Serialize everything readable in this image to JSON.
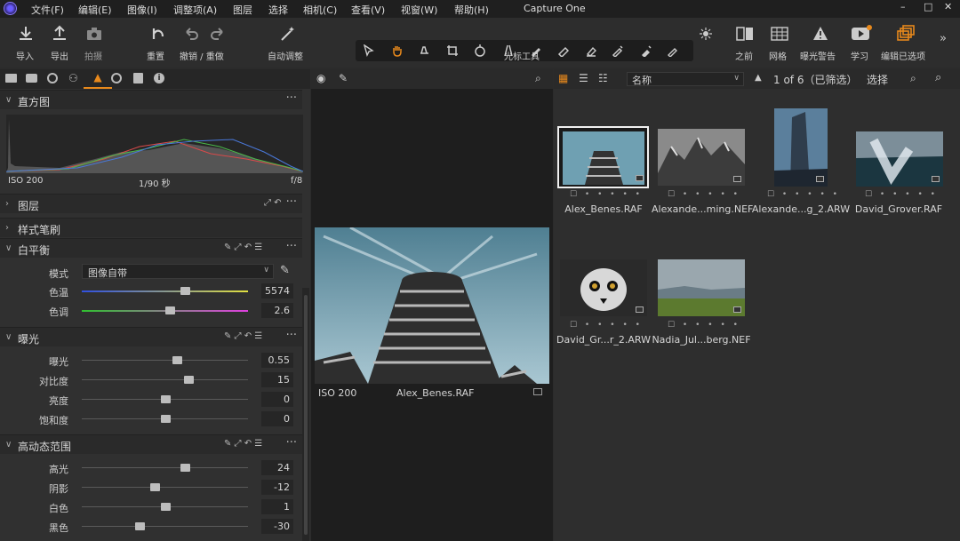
{
  "app": {
    "title": "Capture One"
  },
  "menu": [
    "文件(F)",
    "编辑(E)",
    "图像(I)",
    "调整项(A)",
    "图层",
    "选择",
    "相机(C)",
    "查看(V)",
    "视窗(W)",
    "帮助(H)"
  ],
  "toolbar": {
    "import": "导入",
    "export": "导出",
    "capture": "拍摄",
    "reset": "重置",
    "undo_redo": "撤销 / 重做",
    "auto_adjust": "自动调整",
    "cursor_tools": "光标工具",
    "before": "之前",
    "grid": "网格",
    "exposure_warning": "曝光警告",
    "learn": "学习",
    "edit_selected": "编辑已选项"
  },
  "histogram": {
    "title": "直方图",
    "iso": "ISO 200",
    "shutter": "1/90 秒",
    "aperture": "f/8"
  },
  "sections": {
    "layers": "图层",
    "style_brushes": "样式笔刷",
    "white_balance": "白平衡",
    "exposure": "曝光",
    "hdr": "高动态范围"
  },
  "white_balance": {
    "mode_label": "模式",
    "mode_value": "图像自带",
    "rows": [
      {
        "label": "色温",
        "value": "5574",
        "pos": 0.62
      },
      {
        "label": "色调",
        "value": "2.6",
        "pos": 0.53
      }
    ]
  },
  "exposure": {
    "rows": [
      {
        "label": "曝光",
        "value": "0.55",
        "pos": 0.57
      },
      {
        "label": "对比度",
        "value": "15",
        "pos": 0.64
      },
      {
        "label": "亮度",
        "value": "0",
        "pos": 0.5
      },
      {
        "label": "饱和度",
        "value": "0",
        "pos": 0.5
      }
    ]
  },
  "hdr": {
    "rows": [
      {
        "label": "高光",
        "value": "24",
        "pos": 0.62
      },
      {
        "label": "阴影",
        "value": "-12",
        "pos": 0.44
      },
      {
        "label": "白色",
        "value": "1",
        "pos": 0.505
      },
      {
        "label": "黑色",
        "value": "-30",
        "pos": 0.35
      }
    ]
  },
  "viewer": {
    "iso": "ISO 200",
    "filename": "Alex_Benes.RAF"
  },
  "browser": {
    "sort": "名称",
    "count": "1 of 6（已筛选）",
    "select": "选择",
    "thumbs": [
      {
        "name": "Alex_Benes.RAF"
      },
      {
        "name": "Alexande...ming.NEF"
      },
      {
        "name": "Alexande...g_2.ARW"
      },
      {
        "name": "David_Grover.RAF"
      },
      {
        "name": "David_Gr...r_2.ARW"
      },
      {
        "name": "Nadia_Jul...berg.NEF"
      }
    ]
  },
  "colors": {
    "accent": "#e8891c",
    "panel": "#303030",
    "viewer_bg": "#1e1e1e"
  }
}
